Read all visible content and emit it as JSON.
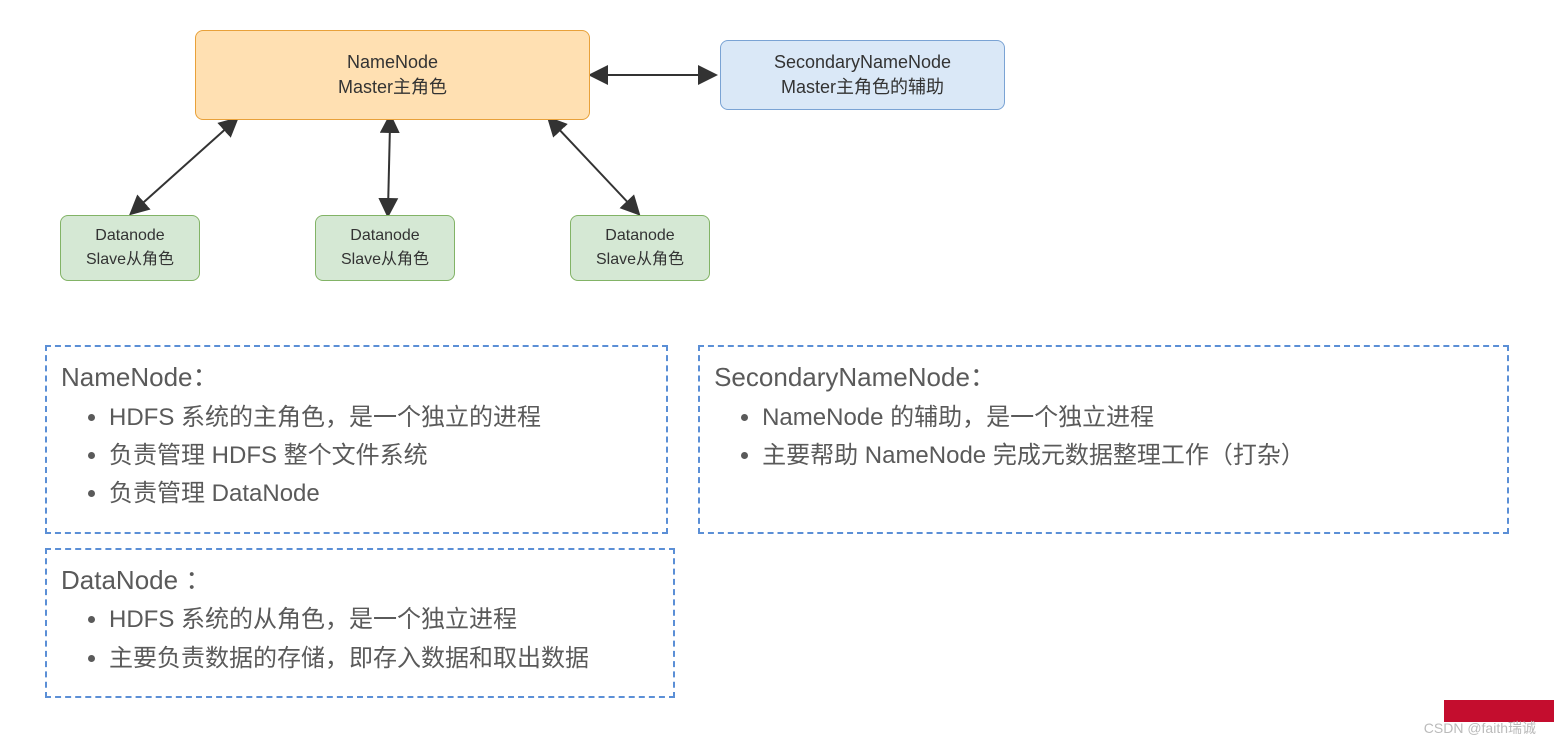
{
  "diagram": {
    "namenode": {
      "line1": "NameNode",
      "line2": "Master主角色"
    },
    "snn": {
      "line1": "SecondaryNameNode",
      "line2": "Master主角色的辅助"
    },
    "datanode": {
      "line1": "Datanode",
      "line2": "Slave从角色"
    }
  },
  "desc": {
    "namenode": {
      "title": "NameNode：",
      "items": [
        "HDFS 系统的主角色，是一个独立的进程",
        "负责管理 HDFS 整个文件系统",
        "负责管理 DataNode"
      ]
    },
    "snn": {
      "title": "SecondaryNameNode：",
      "items": [
        "NameNode 的辅助，是一个独立进程",
        "主要帮助 NameNode 完成元数据整理工作（打杂）"
      ]
    },
    "datanode": {
      "title": "DataNode ：",
      "items": [
        "HDFS 系统的从角色，是一个独立进程",
        "主要负责数据的存储，即存入数据和取出数据"
      ]
    }
  },
  "watermark": "CSDN @faith瑞诚"
}
